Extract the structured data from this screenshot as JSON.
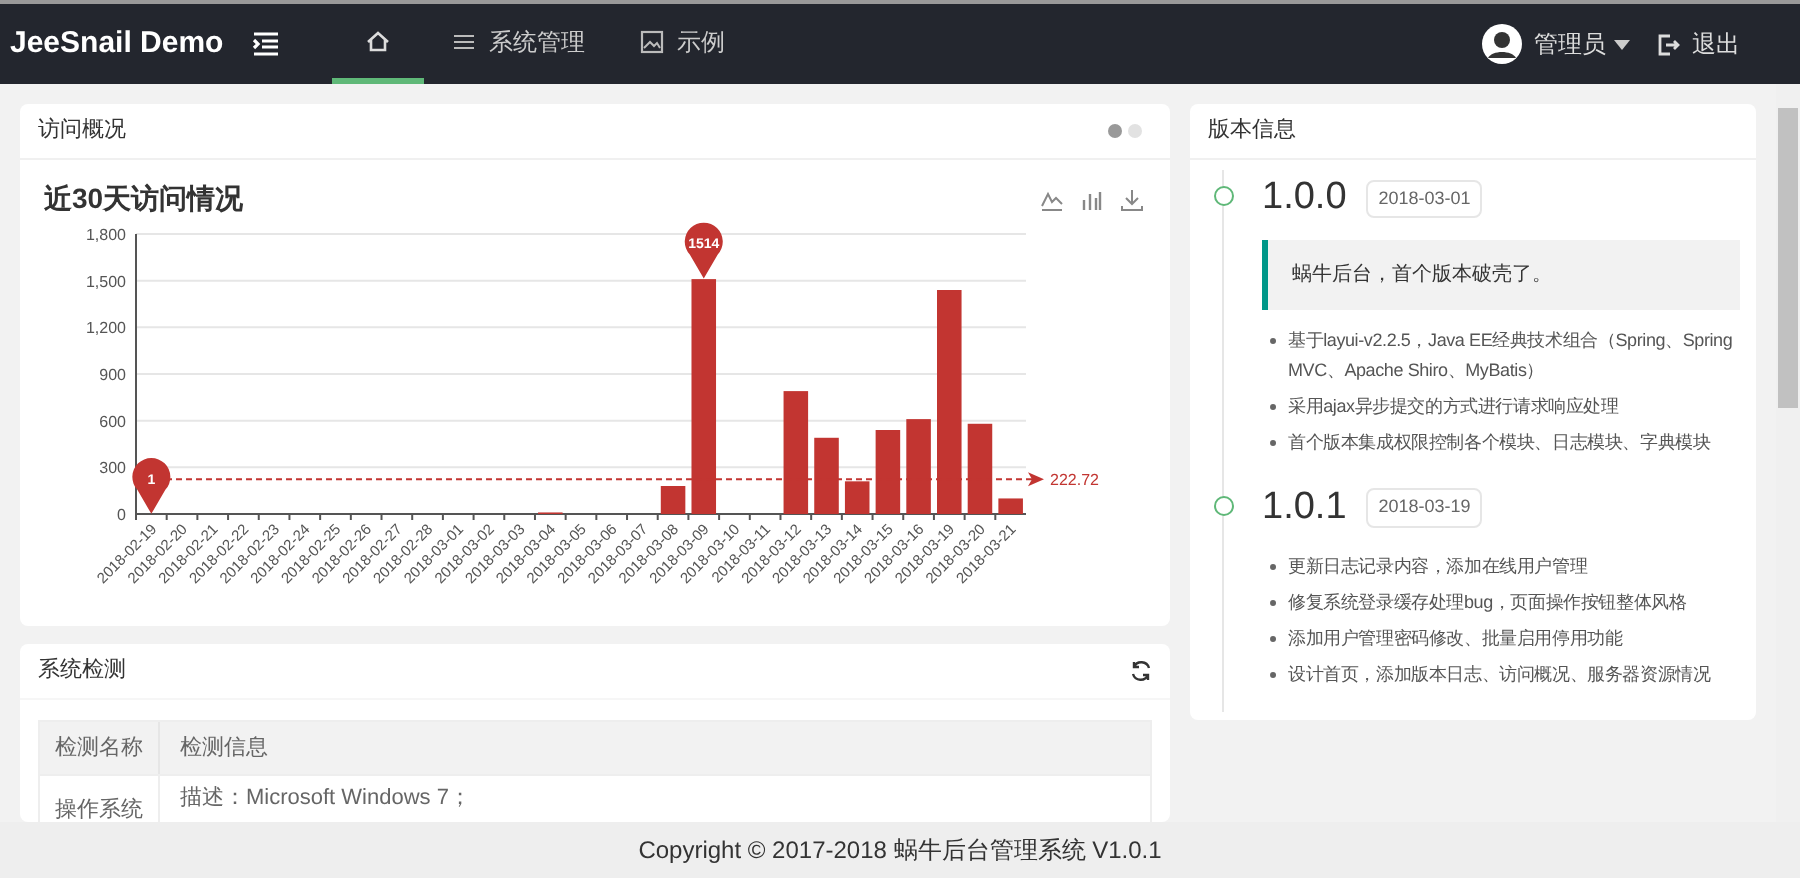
{
  "header": {
    "brand": "JeeSnail Demo",
    "nav": [
      {
        "kind": "home",
        "selected": true
      },
      {
        "kind": "list",
        "label": "系统管理",
        "selected": false
      },
      {
        "kind": "image",
        "label": "示例",
        "selected": false
      }
    ],
    "user": "管理员",
    "logout": "退出"
  },
  "visits": {
    "title": "访问概况",
    "pager": [
      {
        "selected": true
      },
      {
        "selected": false
      }
    ],
    "chart_title": "近30天访问情况",
    "chart_data": {
      "type": "bar",
      "categories": [
        "2018-02-19",
        "2018-02-20",
        "2018-02-21",
        "2018-02-22",
        "2018-02-23",
        "2018-02-24",
        "2018-02-25",
        "2018-02-26",
        "2018-02-27",
        "2018-02-28",
        "2018-03-01",
        "2018-03-02",
        "2018-03-03",
        "2018-03-04",
        "2018-03-05",
        "2018-03-06",
        "2018-03-07",
        "2018-03-08",
        "2018-03-09",
        "2018-03-10",
        "2018-03-11",
        "2018-03-12",
        "2018-03-13",
        "2018-03-14",
        "2018-03-15",
        "2018-03-16",
        "2018-03-19",
        "2018-03-20",
        "2018-03-21"
      ],
      "series": [
        {
          "color": "#c23531",
          "values": [
            0,
            0,
            0,
            0,
            0,
            0,
            0,
            0,
            0,
            0,
            0,
            0,
            0,
            10,
            0,
            0,
            0,
            180,
            1510,
            0,
            0,
            790,
            490,
            210,
            540,
            610,
            1440,
            580,
            100
          ]
        }
      ],
      "grid": true,
      "ylim": [
        0,
        1800
      ],
      "yticks": [
        {
          "value": 0,
          "label": "0"
        },
        {
          "value": 300,
          "label": "300"
        },
        {
          "value": 600,
          "label": "600"
        },
        {
          "value": 900,
          "label": "900"
        },
        {
          "value": 1200,
          "label": "1,200"
        },
        {
          "value": 1500,
          "label": "1,500"
        },
        {
          "value": 1800,
          "label": "1,800"
        }
      ],
      "annotations": [
        {
          "text": "1514",
          "x": "2018-03-09",
          "y": 1514
        },
        {
          "text": "1",
          "x": "2018-02-19",
          "y": 1
        }
      ],
      "ref_lines": [
        {
          "axis": "y",
          "value": 222.72,
          "label": "222.72"
        }
      ]
    }
  },
  "system": {
    "title": "系统检测",
    "columns": [
      "检测名称",
      "检测信息"
    ],
    "rows": [
      {
        "name": "操作系统",
        "info": "描述：Microsoft Windows 7；"
      }
    ]
  },
  "versions": {
    "title": "版本信息",
    "items": [
      {
        "version": "1.0.0",
        "date": "2018-03-01",
        "quote": "蜗牛后台，首个版本破壳了。",
        "notes": [
          "基于layui-v2.2.5，Java EE经典技术组合（Spring、Spring MVC、Apache Shiro、MyBatis）",
          "采用ajax异步提交的方式进行请求响应处理",
          "首个版本集成权限控制各个模块、日志模块、字典模块"
        ]
      },
      {
        "version": "1.0.1",
        "date": "2018-03-19",
        "notes": [
          "更新日志记录内容，添加在线用户管理",
          "修复系统登录缓存处理bug，页面操作按钮整体风格",
          "添加用户管理密码修改、批量启用停用功能",
          "设计首页，添加版本日志、访问概况、服务器资源情况"
        ]
      }
    ]
  },
  "footer": "Copyright © 2017-2018 蜗牛后台管理系统 V1.0.1"
}
